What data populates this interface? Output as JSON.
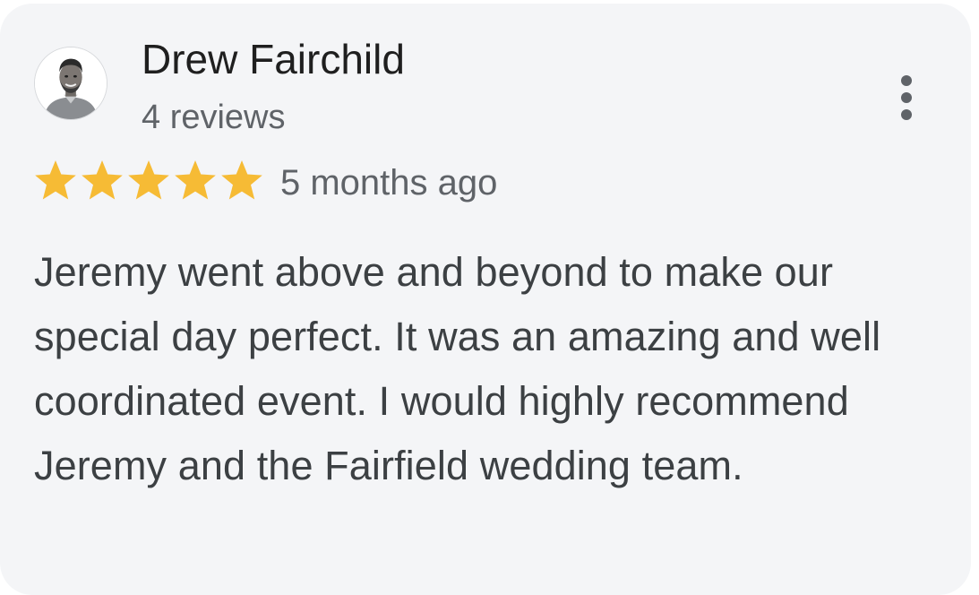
{
  "review": {
    "reviewer": {
      "name": "Drew Fairchild",
      "review_count_text": "4 reviews",
      "avatar_icon": "user-avatar-photo"
    },
    "rating": {
      "stars": 5,
      "max_stars": 5,
      "star_color": "#f6bb35"
    },
    "time_ago": "5 months ago",
    "text": "Jeremy went above and beyond to make our special day perfect. It was an amazing and well coordinated event. I would highly recommend Jeremy and the Fairfield wedding team.",
    "menu_icon": "more-vertical-icon"
  },
  "theme": {
    "card_background": "#f4f5f7",
    "name_color": "#1f1f1f",
    "meta_color": "#5f6368",
    "body_color": "#3c4043"
  }
}
